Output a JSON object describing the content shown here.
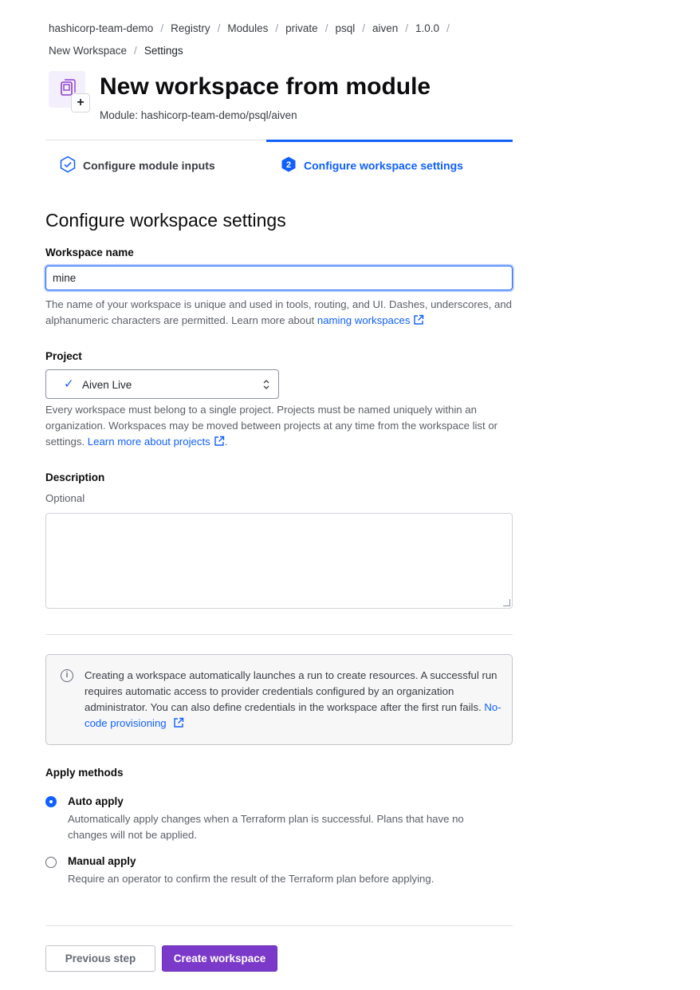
{
  "breadcrumb": {
    "items": [
      "hashicorp-team-demo",
      "Registry",
      "Modules",
      "private",
      "psql",
      "aiven",
      "1.0.0",
      "New Workspace"
    ],
    "current": "Settings"
  },
  "header": {
    "title": "New workspace from module",
    "subtitle": "Module: hashicorp-team-demo/psql/aiven"
  },
  "steps": [
    {
      "label": "Configure module inputs",
      "state": "complete"
    },
    {
      "label": "Configure workspace settings",
      "number": "2",
      "state": "active"
    }
  ],
  "form": {
    "heading": "Configure workspace settings",
    "workspace_name": {
      "label": "Workspace name",
      "value": "mine",
      "help": "The name of your workspace is unique and used in tools, routing, and UI. Dashes, underscores, and alphanumeric characters are permitted. Learn more about",
      "link": "naming workspaces"
    },
    "project": {
      "label": "Project",
      "selected": "Aiven Live",
      "help": "Every workspace must belong to a single project. Projects must be named uniquely within an organization. Workspaces may be moved between projects at any time from the workspace list or settings.",
      "link": "Learn more about projects",
      "trailing": "."
    },
    "description": {
      "label": "Description",
      "hint": "Optional",
      "value": ""
    },
    "notice": {
      "text": "Creating a workspace automatically launches a run to create resources. A successful run requires automatic access to provider credentials configured by an organization administrator. You can also define credentials in the workspace after the first run fails.",
      "link": "No-code provisioning"
    },
    "apply_methods": {
      "label": "Apply methods",
      "options": [
        {
          "label": "Auto apply",
          "description": "Automatically apply changes when a Terraform plan is successful. Plans that have no changes will not be applied.",
          "selected": true
        },
        {
          "label": "Manual apply",
          "description": "Require an operator to confirm the result of the Terraform plan before applying.",
          "selected": false
        }
      ]
    }
  },
  "actions": {
    "previous": "Previous step",
    "create": "Create workspace"
  },
  "colors": {
    "accent": "#1060ff",
    "primary_button": "#7b39c9"
  }
}
